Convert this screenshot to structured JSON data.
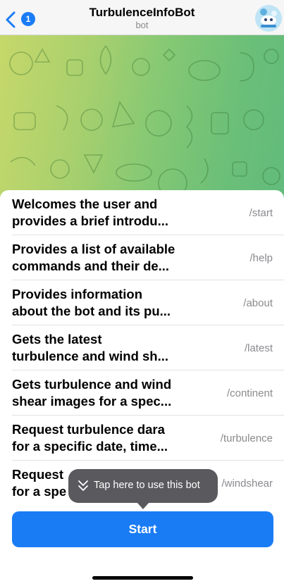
{
  "header": {
    "back_badge": "1",
    "title": "TurbulenceInfoBot",
    "subtitle": "bot"
  },
  "commands": [
    {
      "desc_line1": "Welcomes the user and",
      "desc_line2": "provides a brief introdu...",
      "command": "/start"
    },
    {
      "desc_line1": "Provides a list of available",
      "desc_line2": "commands and their de...",
      "command": "/help"
    },
    {
      "desc_line1": "Provides information",
      "desc_line2": "about the bot and its pu...",
      "command": "/about"
    },
    {
      "desc_line1": "Gets the latest",
      "desc_line2": "turbulence and wind sh...",
      "command": "/latest"
    },
    {
      "desc_line1": "Gets turbulence and wind",
      "desc_line2": "shear images for a spec...",
      "command": "/continent"
    },
    {
      "desc_line1": "Request turbulence dara",
      "desc_line2": "for a specific date, time...",
      "command": "/turbulence"
    },
    {
      "desc_line1": "Request",
      "desc_line2": "for a spe",
      "command": "/windshear"
    }
  ],
  "tooltip": {
    "text": "Tap here to use this bot",
    "icon": "double-chevron-down-icon"
  },
  "start_button": {
    "label": "Start"
  },
  "colors": {
    "accent": "#1a7cf5",
    "tooltip_bg": "#5a5a5e",
    "secondary_text": "#8a8a8e"
  }
}
